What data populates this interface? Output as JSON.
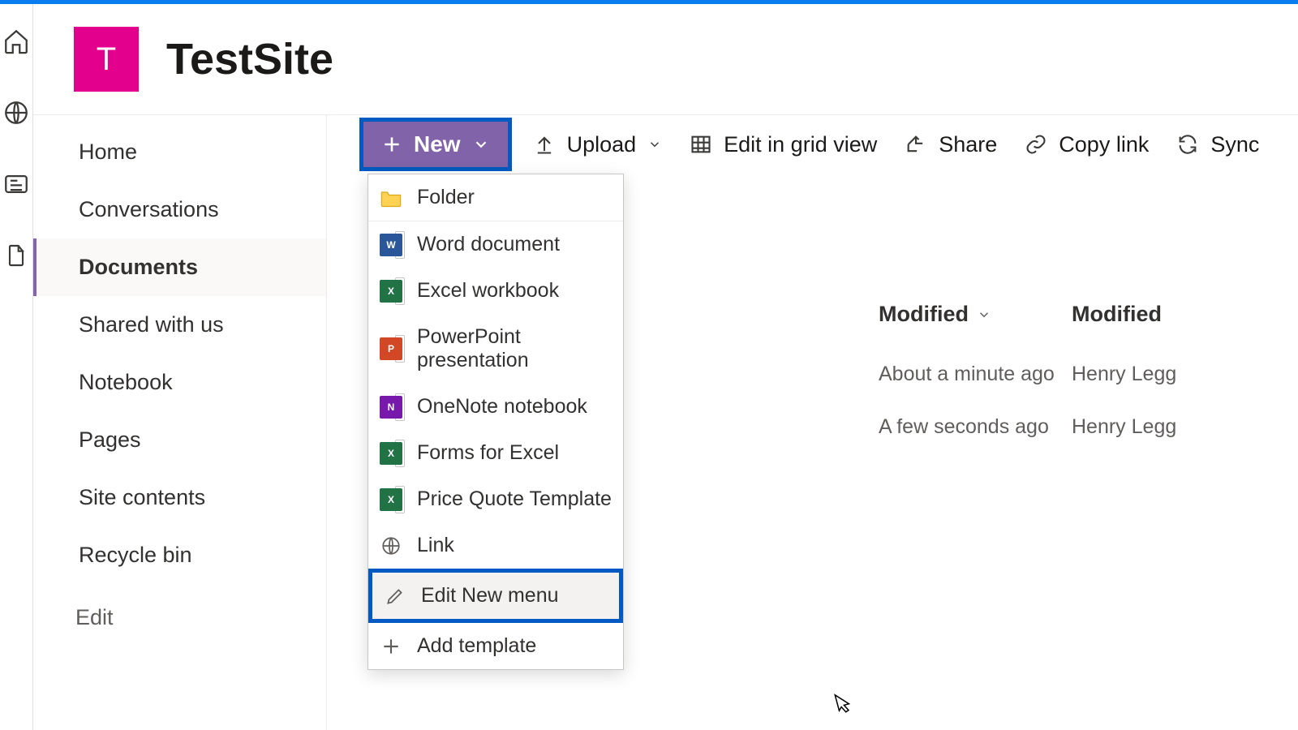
{
  "site": {
    "initial": "T",
    "title": "TestSite"
  },
  "nav": {
    "items": [
      "Home",
      "Conversations",
      "Documents",
      "Shared with us",
      "Notebook",
      "Pages",
      "Site contents",
      "Recycle bin"
    ],
    "selected_index": 2,
    "edit": "Edit"
  },
  "toolbar": {
    "new": "New",
    "upload": "Upload",
    "grid": "Edit in grid view",
    "share": "Share",
    "copy": "Copy link",
    "sync": "Sync"
  },
  "new_menu": {
    "folder": "Folder",
    "word": "Word document",
    "excel": "Excel workbook",
    "ppt": "PowerPoint presentation",
    "onenote": "OneNote notebook",
    "forms": "Forms for Excel",
    "quote": "Price Quote Template",
    "link": "Link",
    "edit_menu": "Edit New menu",
    "add_template": "Add template"
  },
  "columns": {
    "modified": "Modified",
    "modified_by": "Modified"
  },
  "rows": [
    {
      "modified": "About a minute ago",
      "by": "Henry Legg"
    },
    {
      "modified": "A few seconds ago",
      "by": "Henry Legg"
    }
  ]
}
